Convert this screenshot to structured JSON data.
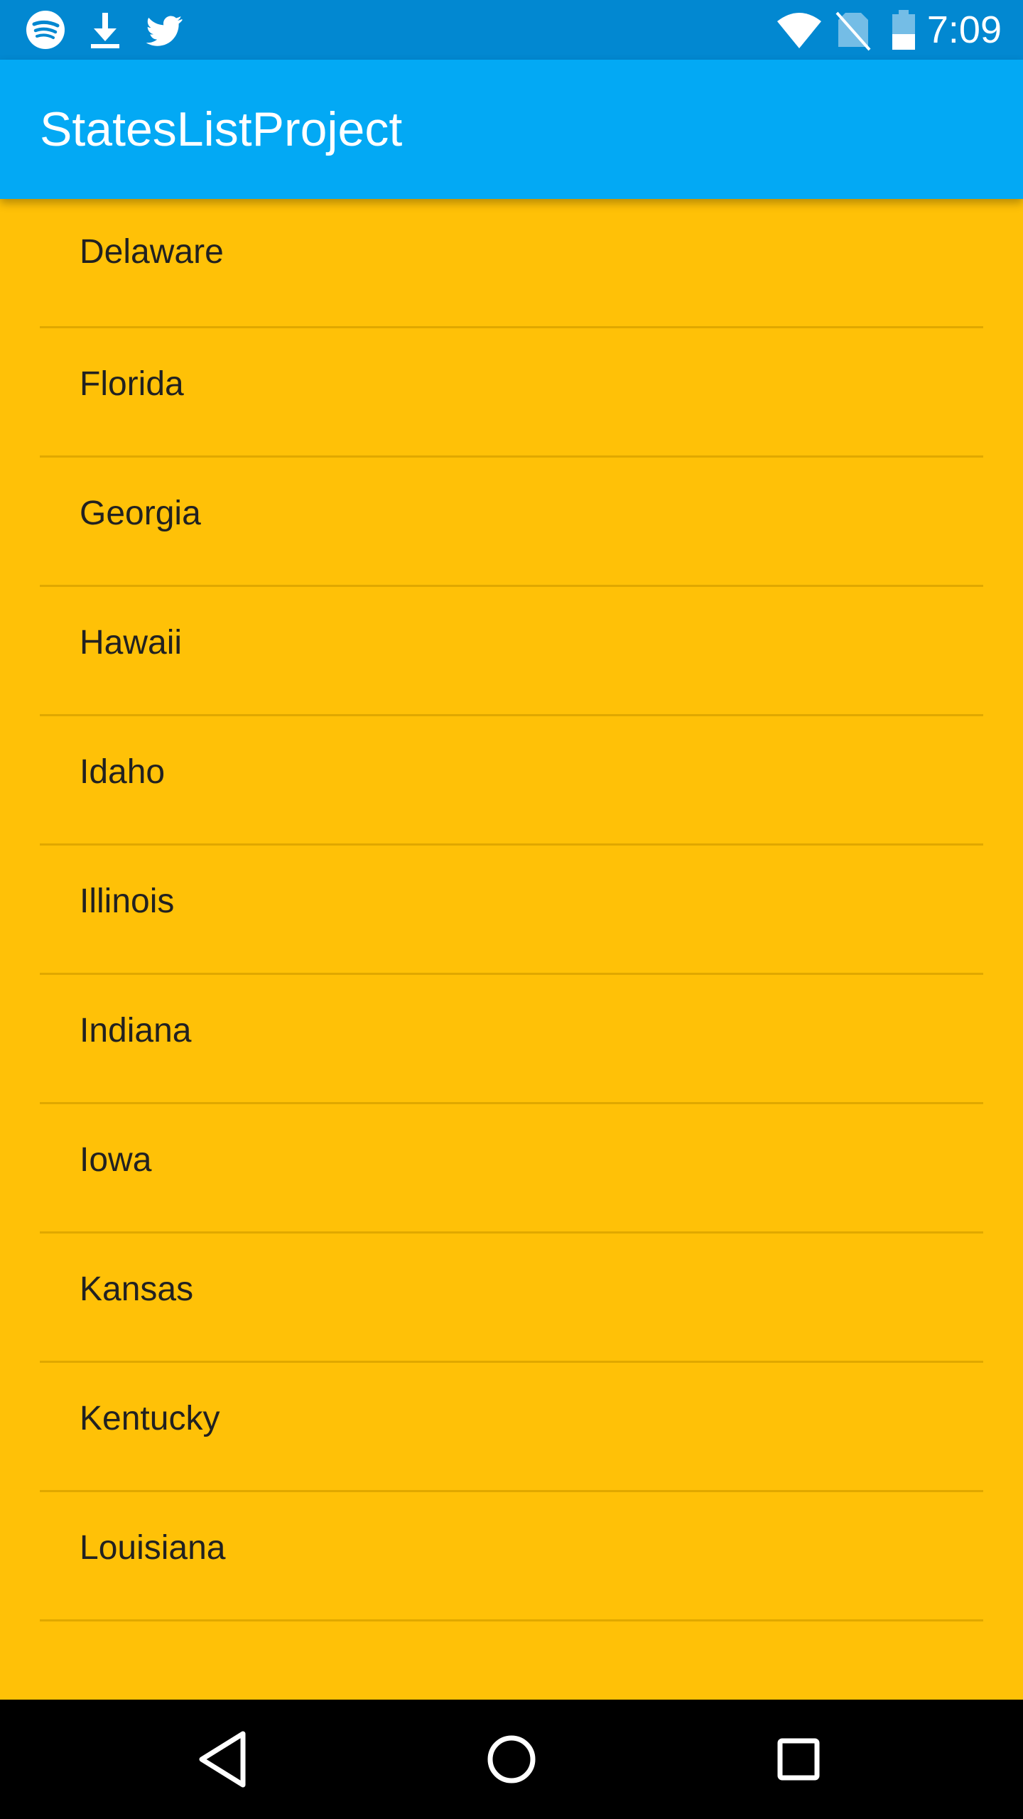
{
  "status_bar": {
    "time": "7:09",
    "left_icons": [
      "spotify-icon",
      "download-icon",
      "twitter-icon"
    ],
    "right_icons": [
      "wifi-icon",
      "no-sim-icon",
      "battery-icon"
    ]
  },
  "app_bar": {
    "title": "StatesListProject"
  },
  "states": [
    {
      "label": "Delaware"
    },
    {
      "label": "Florida"
    },
    {
      "label": "Georgia"
    },
    {
      "label": "Hawaii"
    },
    {
      "label": "Idaho"
    },
    {
      "label": "Illinois"
    },
    {
      "label": "Indiana"
    },
    {
      "label": "Iowa"
    },
    {
      "label": "Kansas"
    },
    {
      "label": "Kentucky"
    },
    {
      "label": "Louisiana"
    }
  ],
  "nav_bar": {
    "buttons": [
      "back-icon",
      "home-icon",
      "recents-icon"
    ]
  },
  "colors": {
    "status_bar": "#0288D1",
    "app_bar": "#03A9F4",
    "list_background": "#FFC107",
    "divider": "#E0A800",
    "nav_bar": "#000000"
  }
}
